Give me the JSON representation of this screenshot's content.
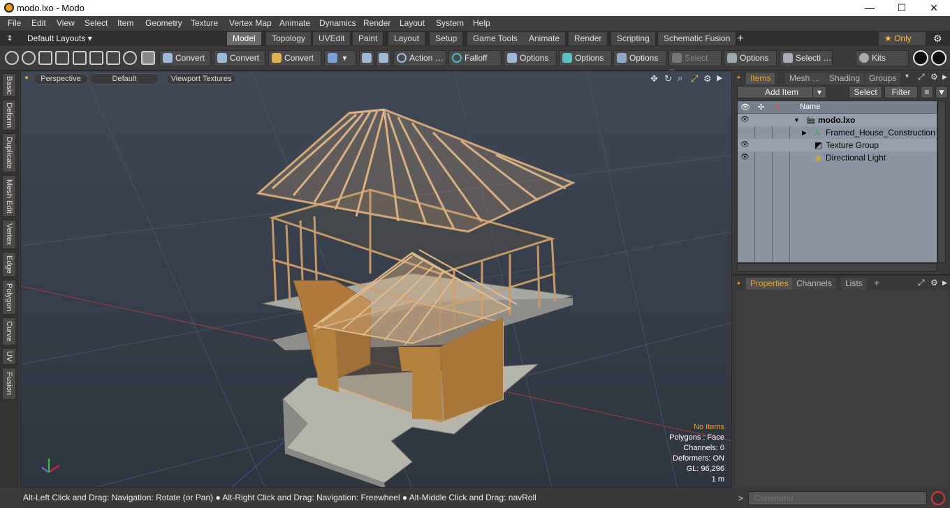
{
  "window": {
    "title": "modo.lxo - Modo",
    "minimize": "—",
    "maximize": "☐",
    "close": "✕"
  },
  "menu": [
    "File",
    "Edit",
    "View",
    "Select",
    "Item",
    "Geometry",
    "Texture",
    "Vertex Map",
    "Animate",
    "Dynamics",
    "Render",
    "Layout",
    "System",
    "Help"
  ],
  "layouts": {
    "label": "Default Layouts ▾"
  },
  "tabs": [
    "Model",
    "Topology",
    "UVEdit",
    "Paint",
    "Layout",
    "Setup",
    "Game Tools",
    "Animate",
    "Render",
    "Scripting",
    "Schematic Fusion"
  ],
  "tab_add": "+",
  "only_label": "★  Only",
  "toolbar": {
    "convert1": "Convert",
    "convert2": "Convert",
    "convert3": "Convert",
    "action": "Action  …",
    "falloff": "Falloff",
    "options1": "Options",
    "options2": "Options",
    "options3": "Options",
    "select_t": "Select T…",
    "options4": "Options",
    "selecti": "Selecti …",
    "kits": "Kits"
  },
  "left_tabs": [
    "Basic",
    "Deform",
    "Duplicate",
    "Mesh Edit",
    "Vertex",
    "Edge",
    "Polygon",
    "Curve",
    "UV",
    "Fusion"
  ],
  "viewport": {
    "view": "Perspective",
    "shading": "Default",
    "textures": "Viewport Textures",
    "hud": {
      "no_items": "No Items",
      "polygons": "Polygons : Face",
      "channels": "Channels: 0",
      "deformers": "Deformers: ON",
      "gl": "GL: 96,296",
      "scale": "1 m"
    }
  },
  "status": "Alt-Left Click and Drag: Navigation: Rotate (or Pan) ● Alt-Right Click and Drag: Navigation: Freewheel ● Alt-Middle Click and Drag: navRoll",
  "items_panel": {
    "tabs": [
      "Items",
      "Mesh …",
      "Shading",
      "Groups"
    ],
    "add_item": "Add Item",
    "select": "Select",
    "filter": "Filter",
    "col_name": "Name",
    "rows": [
      {
        "name": "modo.lxo",
        "eye": true
      },
      {
        "name": "Framed_House_Construction",
        "eye": false
      },
      {
        "name": "Texture Group",
        "eye": true
      },
      {
        "name": "Directional Light",
        "eye": true
      }
    ]
  },
  "props_panel": {
    "tabs": [
      "Properties",
      "Channels",
      "Lists"
    ],
    "add": "+"
  },
  "command": {
    "placeholder": "Command",
    "prompt": ">"
  },
  "colors": {
    "accent": "#f0a020",
    "viewport_top": "#3f4755"
  }
}
